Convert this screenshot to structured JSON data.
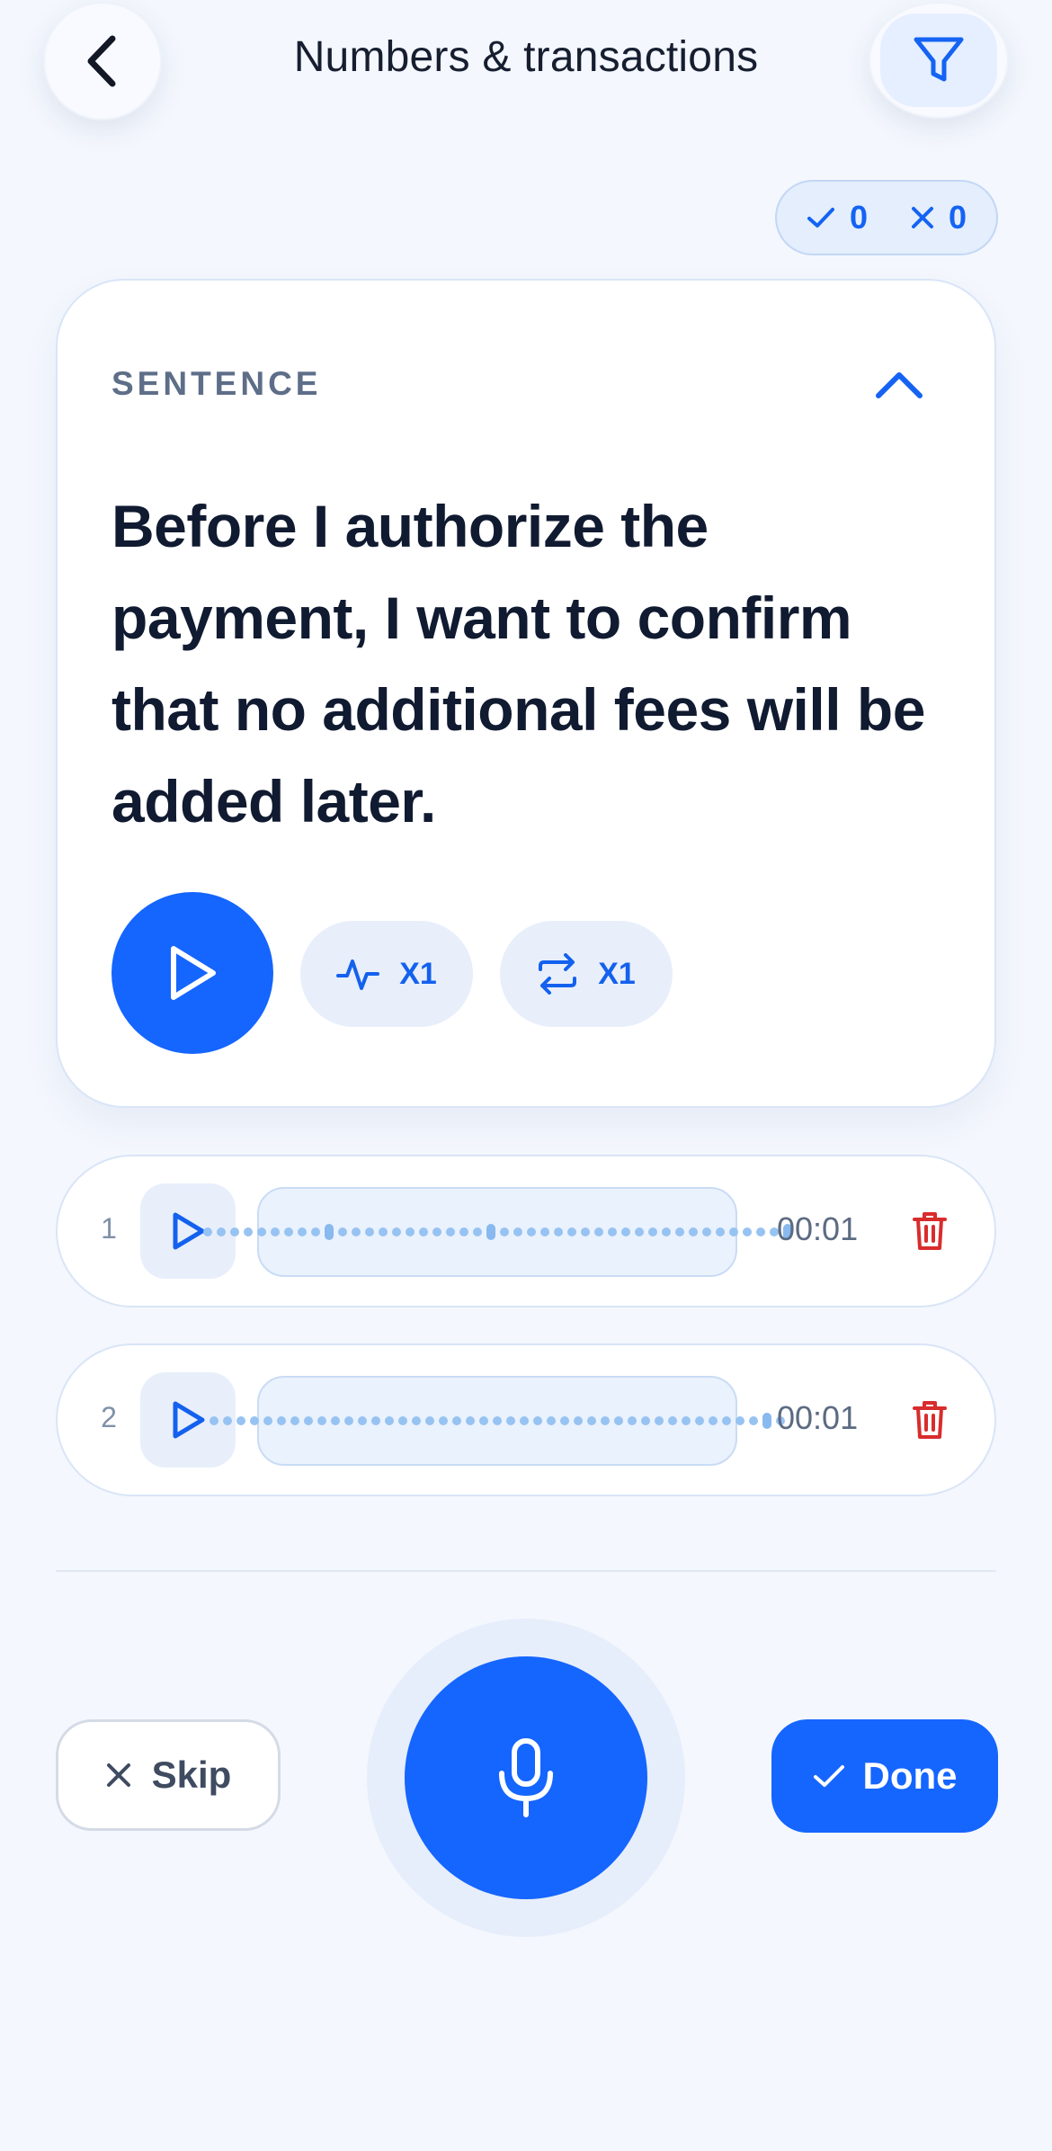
{
  "header": {
    "title": "Numbers & transactions",
    "back_icon": "chevron-left-icon",
    "filter_icon": "filter-icon"
  },
  "score": {
    "correct": "0",
    "incorrect": "0"
  },
  "card": {
    "label": "SENTENCE",
    "sentence": "Before I authorize the payment, I want to confirm that no additional fees will be added later.",
    "speed_chip": "X1",
    "repeat_chip": "X1"
  },
  "recordings": [
    {
      "index": "1",
      "duration": "00:01"
    },
    {
      "index": "2",
      "duration": "00:01"
    }
  ],
  "actions": {
    "skip_label": "Skip",
    "done_label": "Done"
  },
  "colors": {
    "accent": "#1565ff",
    "delete": "#d92c2c",
    "background": "#f4f7fd"
  }
}
